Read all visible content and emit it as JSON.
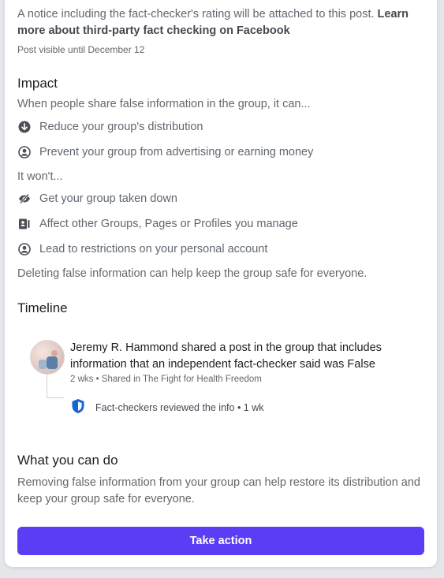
{
  "notice": {
    "text": "A notice including the fact-checker's rating will be attached to this post. ",
    "learn_more": "Learn more about third-party fact checking on Facebook",
    "visible_until": "Post visible until December 12"
  },
  "impact": {
    "heading": "Impact",
    "intro": "When people share false information in the group, it can...",
    "can_items": [
      {
        "icon": "arrow-down-circle-icon",
        "label": "Reduce your group's distribution"
      },
      {
        "icon": "user-circle-icon",
        "label": "Prevent your group from advertising or earning money"
      }
    ],
    "wont_intro": "It won't...",
    "wont_items": [
      {
        "icon": "eye-off-icon",
        "label": "Get your group taken down"
      },
      {
        "icon": "pages-icon",
        "label": "Affect other Groups, Pages or Profiles you manage"
      },
      {
        "icon": "user-circle-icon",
        "label": "Lead to restrictions on your personal account"
      }
    ],
    "footer": "Deleting false information can help keep the group safe for everyone."
  },
  "timeline": {
    "heading": "Timeline",
    "event_title": "Jeremy R. Hammond shared a post in the group that includes information that an independent fact-checker said was False",
    "event_meta": "2 wks • Shared in The Fight for Health Freedom",
    "review_text": "Fact-checkers reviewed the info • 1 wk"
  },
  "what_you_can_do": {
    "heading": "What you can do",
    "text": "Removing false information from your group can help restore its distribution and keep your group safe for everyone."
  },
  "action": {
    "button_label": "Take action"
  },
  "colors": {
    "accent": "#5b3df5",
    "shield": "#1763cf"
  }
}
